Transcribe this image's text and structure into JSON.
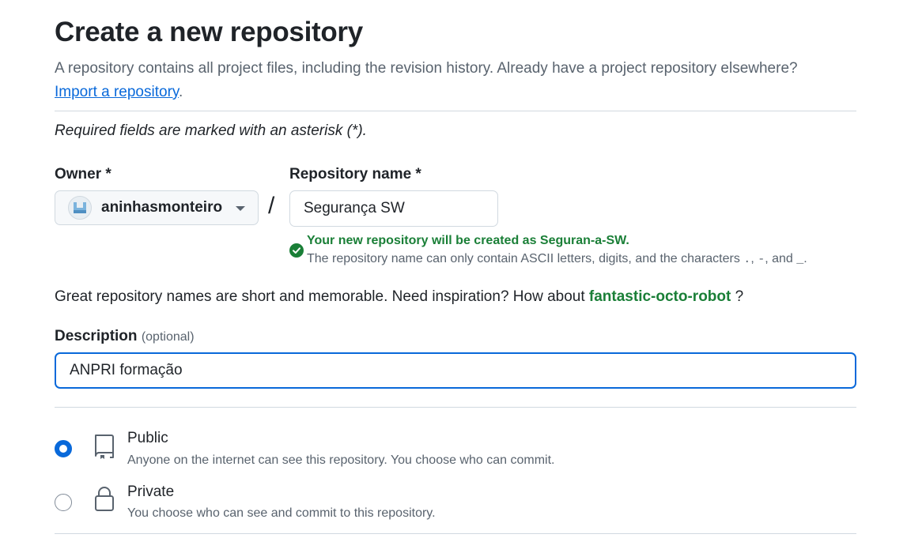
{
  "page": {
    "title": "Create a new repository",
    "lead": "A repository contains all project files, including the revision history. Already have a project repository elsewhere?",
    "import_link": "Import a repository",
    "import_suffix": ".",
    "required_note": "Required fields are marked with an asterisk (*)."
  },
  "owner": {
    "label": "Owner *",
    "value": "aninhasmonteiro",
    "avatar_icon": "user-avatar-icon"
  },
  "separator": "/",
  "repo_name": {
    "label": "Repository name *",
    "value": "Segurança SW",
    "validation_ok": "Your new repository will be created as Seguran-a-SW.",
    "validation_note_prefix": "The repository name can only contain ASCII letters, digits, and the characters",
    "validation_chars": ".",
    "validation_comma1": ",",
    "validation_char2": "-",
    "validation_comma2": ", and",
    "validation_char3": "_",
    "validation_end": "."
  },
  "inspiration": {
    "text": "Great repository names are short and memorable. Need inspiration? How about",
    "suggestion": "fantastic-octo-robot",
    "suffix": "?"
  },
  "description": {
    "label": "Description",
    "optional": "(optional)",
    "value": "ANPRI formação"
  },
  "visibility": {
    "selected": "public",
    "options": [
      {
        "title": "Public",
        "desc": "Anyone on the internet can see this repository. You choose who can commit.",
        "icon": "repo-book-icon"
      },
      {
        "title": "Private",
        "desc": "You choose who can see and commit to this repository.",
        "icon": "lock-icon"
      }
    ]
  },
  "colors": {
    "accent": "#0969da",
    "success": "#1a7f37",
    "muted": "#59636e",
    "border": "#d1d9e0"
  }
}
